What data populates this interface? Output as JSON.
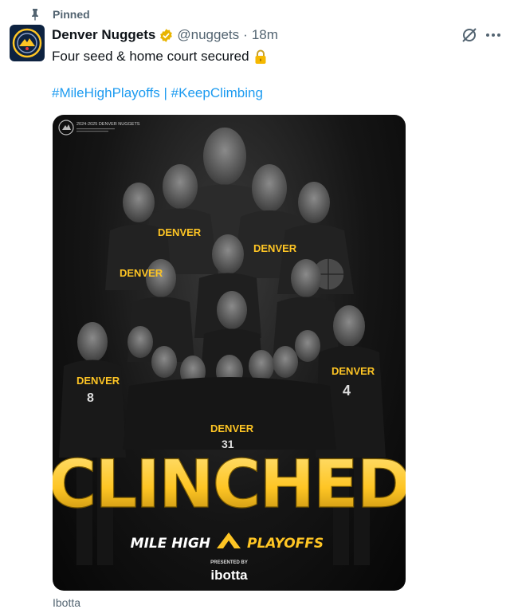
{
  "pinned": {
    "label": "Pinned",
    "icon": "pin-icon"
  },
  "author": {
    "name": "Denver Nuggets",
    "handle": "@nuggets",
    "separator": "·",
    "time": "18m",
    "verified": true,
    "verified_color": "#e8b400",
    "avatar_colors": {
      "navy": "#0d2240",
      "gold": "#fec524"
    }
  },
  "tweet": {
    "text": "Four seed & home court secured",
    "emoji_icon": "lock-icon",
    "hashtags": [
      "#MileHighPlayoffs",
      "|",
      "#KeepClimbing"
    ]
  },
  "media": {
    "corner_text": "2024-2025 DENVER NUGGETS",
    "jersey_word": "DENVER",
    "jersey_numbers": [
      "8",
      "4",
      "31"
    ],
    "headline": "CLINCHED",
    "subline_left": "MILE HIGH",
    "subline_right": "PLAYOFFS",
    "presented_by": "PRESENTED BY",
    "sponsor": "ibotta",
    "colors": {
      "gold": "#fec524",
      "gold_dark": "#b8860b",
      "navy": "#0d2240"
    }
  },
  "caption_partial": "Ibotta"
}
